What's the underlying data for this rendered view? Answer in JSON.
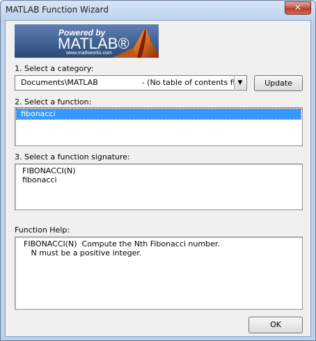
{
  "window": {
    "title": "MATLAB Function Wizard",
    "close_glyph": "✕"
  },
  "logo": {
    "powered_by": "Powered by",
    "brand": "MATLAB®",
    "url": "www.mathworks.com"
  },
  "category": {
    "label": "1. Select a category:",
    "selected_value": "Documents\\MATLAB                  - (No table of contents file)",
    "arrow_glyph": "▼",
    "update_label": "Update"
  },
  "function": {
    "label": "2. Select a function:",
    "items": [
      "fibonacci"
    ]
  },
  "signature": {
    "label": "3. Select a function signature:",
    "items": [
      "FIBONACCI(N)",
      "fibonacci"
    ]
  },
  "help": {
    "label": "Function Help:",
    "lines": [
      "FIBONACCI(N)  Compute the Nth Fibonacci number.",
      "   N must be a positive integer."
    ]
  },
  "ok_label": "OK",
  "colors": {
    "selection": "#3399ff",
    "close_button": "#c75050",
    "logo_background": "#3b5c8e"
  }
}
